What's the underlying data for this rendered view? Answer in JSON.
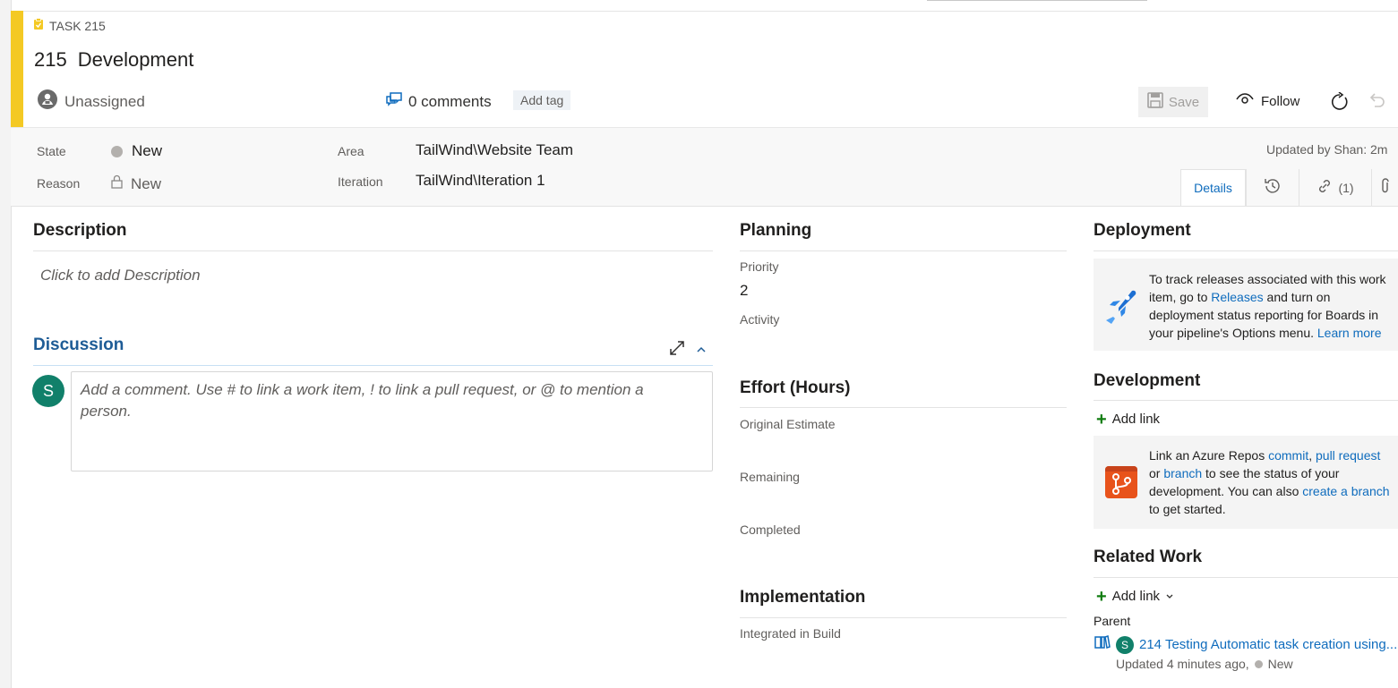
{
  "header": {
    "work_item_type": "TASK 215",
    "id": "215",
    "title": "Development",
    "assigned_to": "Unassigned",
    "comments": "0 comments",
    "add_tag": "Add tag",
    "save": "Save",
    "follow": "Follow"
  },
  "fields": {
    "state_label": "State",
    "state_value": "New",
    "reason_label": "Reason",
    "reason_value": "New",
    "area_label": "Area",
    "area_value": "TailWind\\Website Team",
    "iteration_label": "Iteration",
    "iteration_value": "TailWind\\Iteration 1",
    "updated_by": "Updated by Shan: 2m"
  },
  "tabs": {
    "details": "Details",
    "links": "(1)"
  },
  "description": {
    "heading": "Description",
    "placeholder": "Click to add Description"
  },
  "discussion": {
    "heading": "Discussion",
    "avatar": "S",
    "placeholder": "Add a comment. Use # to link a work item, ! to link a pull request, or @ to mention a person."
  },
  "planning": {
    "heading": "Planning",
    "priority_label": "Priority",
    "priority_value": "2",
    "activity_label": "Activity"
  },
  "effort": {
    "heading": "Effort (Hours)",
    "original_estimate": "Original Estimate",
    "remaining": "Remaining",
    "completed": "Completed"
  },
  "implementation": {
    "heading": "Implementation",
    "integrated_in_build": "Integrated in Build"
  },
  "deployment": {
    "heading": "Deployment",
    "text1": "To track releases associated with this work",
    "text2a": "item, go to ",
    "releases_link": "Releases",
    "text2b": " and turn on",
    "text3": "deployment status reporting for Boards in",
    "text4": "your pipeline's Options menu. ",
    "learn_more": "Learn more"
  },
  "development": {
    "heading": "Development",
    "add_link": "Add link",
    "text1a": "Link an Azure Repos ",
    "commit_link": "commit",
    "comma": ", ",
    "pull_request_link": "pull request",
    "text2a": "or ",
    "branch_link": "branch",
    "text2b": " to see the status of your",
    "text3a": "development. You can also ",
    "create_branch_link": "create a branch",
    "text4": "to get started."
  },
  "related_work": {
    "heading": "Related Work",
    "add_link": "Add link",
    "parent_label": "Parent",
    "parent_avatar": "S",
    "parent_id": "214",
    "parent_title": "Testing Automatic task creation using...",
    "parent_updated": "Updated 4 minutes ago,",
    "parent_state": "New"
  },
  "colors": {
    "task_accent": "#f4c924",
    "link": "#0f6cbd",
    "avatar": "#11806a"
  }
}
